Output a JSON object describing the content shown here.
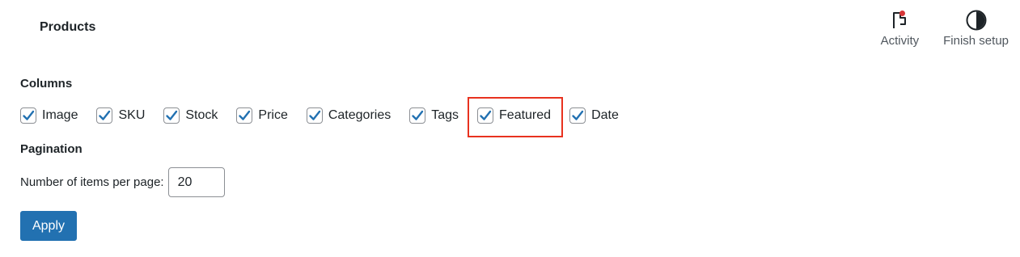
{
  "header": {
    "title": "Products",
    "actions": [
      {
        "label": "Activity",
        "icon": "flag-icon",
        "has_notification": true
      },
      {
        "label": "Finish setup",
        "icon": "half-circle-icon"
      }
    ]
  },
  "screen_options": {
    "columns_heading": "Columns",
    "columns": [
      {
        "label": "Image",
        "checked": true
      },
      {
        "label": "SKU",
        "checked": true
      },
      {
        "label": "Stock",
        "checked": true
      },
      {
        "label": "Price",
        "checked": true
      },
      {
        "label": "Categories",
        "checked": true
      },
      {
        "label": "Tags",
        "checked": true
      },
      {
        "label": "Featured",
        "checked": true,
        "highlighted": true
      },
      {
        "label": "Date",
        "checked": true
      }
    ],
    "pagination_heading": "Pagination",
    "items_per_page_label": "Number of items per page:",
    "items_per_page_value": "20",
    "apply_label": "Apply"
  },
  "colors": {
    "accent": "#2271b1",
    "highlight": "#e8321f",
    "notification_dot": "#d63638"
  }
}
